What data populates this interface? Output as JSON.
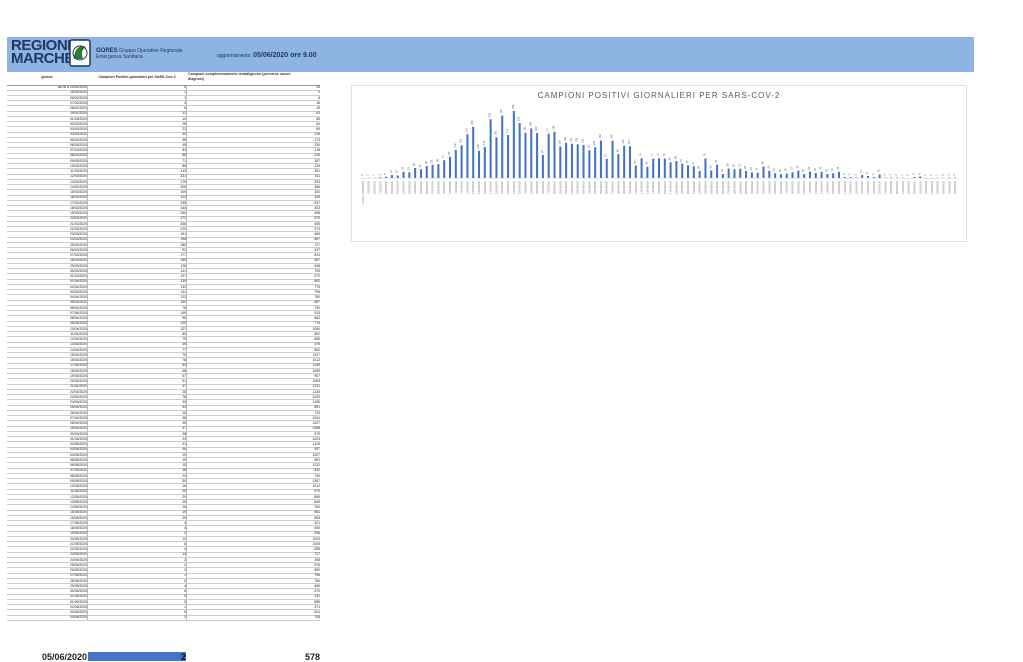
{
  "header": {
    "brand_line1": "REGIONE",
    "brand_line2": "MARCHE",
    "org_name": "GORES",
    "org_desc1": "Gruppo Operativo Regionale",
    "org_desc2": "Emergenza Sanitaria",
    "update_label": "aggiornamento:",
    "update_value": "05/06/2020 ore 9.00"
  },
  "table": {
    "col_day": "giorno",
    "col_positive": "Campioni Positivi giornalieri per SARS-Cov-2",
    "col_tested": "Campioni complessivamente testati/giorno (percorso nuove diagnosi)",
    "rows": [
      {
        "d": "da 06 a 24/02/2020",
        "p": "0",
        "c": "34"
      },
      {
        "d": "25/02/2020",
        "p": "1",
        "c": "3"
      },
      {
        "d": "26/02/2020",
        "p": "1",
        "c": "8"
      },
      {
        "d": "27/02/2020",
        "p": "3",
        "c": "16"
      },
      {
        "d": "28/02/2020",
        "p": "5",
        "c": "19"
      },
      {
        "d": "29/02/2020",
        "p": "12",
        "c": "63"
      },
      {
        "d": "01/03/2020",
        "p": "10",
        "c": "56"
      },
      {
        "d": "02/03/2020",
        "p": "25",
        "c": "64"
      },
      {
        "d": "03/03/2020",
        "p": "23",
        "c": "89"
      },
      {
        "d": "04/03/2020",
        "p": "40",
        "c": "126"
      },
      {
        "d": "05/03/2020",
        "p": "35",
        "c": "173"
      },
      {
        "d": "06/03/2020",
        "p": "48",
        "c": "230"
      },
      {
        "d": "07/03/2020",
        "p": "53",
        "c": "218"
      },
      {
        "d": "08/03/2020",
        "p": "56",
        "c": "216"
      },
      {
        "d": "09/03/2020",
        "p": "71",
        "c": "187"
      },
      {
        "d": "10/03/2020",
        "p": "85",
        "c": "226"
      },
      {
        "d": "11/03/2020",
        "p": "113",
        "c": "351"
      },
      {
        "d": "12/03/2020",
        "p": "131",
        "c": "311"
      },
      {
        "d": "13/03/2020",
        "p": "175",
        "c": "333"
      },
      {
        "d": "14/03/2020",
        "p": "205",
        "c": "386"
      },
      {
        "d": "15/03/2020",
        "p": "109",
        "c": "300"
      },
      {
        "d": "16/03/2020",
        "p": "124",
        "c": "335"
      },
      {
        "d": "17/03/2020",
        "p": "235",
        "c": "537"
      },
      {
        "d": "18/03/2020",
        "p": "163",
        "c": "403"
      },
      {
        "d": "19/03/2020",
        "p": "250",
        "c": "498"
      },
      {
        "d": "20/03/2020",
        "p": "172",
        "c": "570"
      },
      {
        "d": "21/03/2020",
        "p": "268",
        "c": "655"
      },
      {
        "d": "22/03/2020",
        "p": "220",
        "c": "573"
      },
      {
        "d": "23/03/2020",
        "p": "181",
        "c": "465"
      },
      {
        "d": "24/03/2020",
        "p": "198",
        "c": "667"
      },
      {
        "d": "25/03/2020",
        "p": "180",
        "c": "727"
      },
      {
        "d": "26/03/2020",
        "p": "92",
        "c": "437"
      },
      {
        "d": "27/03/2020",
        "p": "177",
        "c": "824"
      },
      {
        "d": "28/03/2020",
        "p": "185",
        "c": "567"
      },
      {
        "d": "29/03/2020",
        "p": "126",
        "c": "548"
      },
      {
        "d": "30/03/2020",
        "p": "141",
        "c": "705"
      },
      {
        "d": "31/03/2020",
        "p": "137",
        "c": "572"
      },
      {
        "d": "01/04/2020",
        "p": "135",
        "c": "662"
      },
      {
        "d": "02/04/2020",
        "p": "132",
        "c": "775"
      },
      {
        "d": "03/04/2020",
        "p": "111",
        "c": "796"
      },
      {
        "d": "04/04/2020",
        "p": "123",
        "c": "780"
      },
      {
        "d": "05/04/2020",
        "p": "150",
        "c": "667"
      },
      {
        "d": "06/04/2020",
        "p": "76",
        "c": "730"
      },
      {
        "d": "07/04/2020",
        "p": "149",
        "c": "913"
      },
      {
        "d": "08/04/2020",
        "p": "96",
        "c": "662"
      },
      {
        "d": "09/04/2020",
        "p": "129",
        "c": "776"
      },
      {
        "d": "10/04/2020",
        "p": "127",
        "c": "1090"
      },
      {
        "d": "11/04/2020",
        "p": "50",
        "c": "892"
      },
      {
        "d": "12/04/2020",
        "p": "79",
        "c": "656"
      },
      {
        "d": "13/04/2020",
        "p": "45",
        "c": "476"
      },
      {
        "d": "14/04/2020",
        "p": "77",
        "c": "862"
      },
      {
        "d": "15/04/2020",
        "p": "79",
        "c": "1107"
      },
      {
        "d": "16/04/2020",
        "p": "78",
        "c": "1012"
      },
      {
        "d": "17/04/2020",
        "p": "63",
        "c": "1265"
      },
      {
        "d": "18/04/2020",
        "p": "68",
        "c": "1099"
      },
      {
        "d": "19/04/2020",
        "p": "57",
        "c": "907"
      },
      {
        "d": "20/04/2020",
        "p": "51",
        "c": "1063"
      },
      {
        "d": "21/04/2020",
        "p": "47",
        "c": "1011"
      },
      {
        "d": "22/04/2020",
        "p": "28",
        "c": "1130"
      },
      {
        "d": "23/04/2020",
        "p": "78",
        "c": "1020"
      },
      {
        "d": "24/04/2020",
        "p": "30",
        "c": "1155"
      },
      {
        "d": "25/04/2020",
        "p": "53",
        "c": "851"
      },
      {
        "d": "26/04/2020",
        "p": "16",
        "c": "733"
      },
      {
        "d": "27/04/2020",
        "p": "38",
        "c": "1004"
      },
      {
        "d": "28/04/2020",
        "p": "35",
        "c": "1227"
      },
      {
        "d": "29/04/2020",
        "p": "37",
        "c": "1268"
      },
      {
        "d": "30/04/2020",
        "p": "28",
        "c": "979"
      },
      {
        "d": "01/05/2020",
        "p": "23",
        "c": "1003"
      },
      {
        "d": "02/05/2020",
        "p": "21",
        "c": "1125"
      },
      {
        "d": "03/05/2020",
        "p": "46",
        "c": "957"
      },
      {
        "d": "04/05/2020",
        "p": "29",
        "c": "1207"
      },
      {
        "d": "05/05/2020",
        "p": "19",
        "c": "981"
      },
      {
        "d": "06/05/2020",
        "p": "15",
        "c": "1232"
      },
      {
        "d": "07/05/2020",
        "p": "18",
        "c": "832"
      },
      {
        "d": "08/05/2020",
        "p": "23",
        "c": "735"
      },
      {
        "d": "09/05/2020",
        "p": "30",
        "c": "1367"
      },
      {
        "d": "10/05/2020",
        "p": "16",
        "c": "1012"
      },
      {
        "d": "11/05/2020",
        "p": "25",
        "c": "970"
      },
      {
        "d": "12/05/2020",
        "p": "20",
        "c": "865"
      },
      {
        "d": "13/05/2020",
        "p": "25",
        "c": "849"
      },
      {
        "d": "14/05/2020",
        "p": "16",
        "c": "760"
      },
      {
        "d": "15/05/2020",
        "p": "19",
        "c": "981"
      },
      {
        "d": "16/05/2020",
        "p": "25",
        "c": "863"
      },
      {
        "d": "17/05/2020",
        "p": "4",
        "c": "321"
      },
      {
        "d": "18/05/2020",
        "p": "4",
        "c": "690"
      },
      {
        "d": "19/05/2020",
        "p": "2",
        "c": "936"
      },
      {
        "d": "20/05/2020",
        "p": "12",
        "c": "1003"
      },
      {
        "d": "21/05/2020",
        "p": "8",
        "c": "1006"
      },
      {
        "d": "22/05/2020",
        "p": "4",
        "c": "558"
      },
      {
        "d": "23/05/2020",
        "p": "14",
        "c": "717"
      },
      {
        "d": "24/05/2020",
        "p": "2",
        "c": "398"
      },
      {
        "d": "25/05/2020",
        "p": "2",
        "c": "576"
      },
      {
        "d": "26/05/2020",
        "p": "2",
        "c": "890"
      },
      {
        "d": "27/05/2020",
        "p": "1",
        "c": "796"
      },
      {
        "d": "28/05/2020",
        "p": "0",
        "c": "750"
      },
      {
        "d": "29/05/2020",
        "p": "4",
        "c": "586"
      },
      {
        "d": "30/05/2020",
        "p": "6",
        "c": "670"
      },
      {
        "d": "31/05/2020",
        "p": "0",
        "c": "231"
      },
      {
        "d": "01/06/2020",
        "p": "0",
        "c": "589"
      },
      {
        "d": "02/06/2020",
        "p": "1",
        "c": "371"
      },
      {
        "d": "03/06/2020",
        "p": "0",
        "c": "624"
      },
      {
        "d": "04/06/2020",
        "p": "2",
        "c": "708"
      }
    ],
    "footer_date": "05/06/2020",
    "footer_positive": "2",
    "footer_tested": "578"
  },
  "colors": {
    "header_bg": "#8db4e2",
    "bar": "#4472c4",
    "brand": "#1f3864"
  },
  "chart_data": {
    "type": "bar",
    "title": "CAMPIONI POSITIVI GIORNALIERI PER SARS-COV-2",
    "xlabel": "",
    "ylabel": "",
    "grid": false,
    "categories": [
      "da 06 a 24/02/2020",
      "25/02/2020",
      "26/02/2020",
      "27/02/2020",
      "28/02/2020",
      "29/02/2020",
      "01/03/2020",
      "02/03/2020",
      "03/03/2020",
      "04/03/2020",
      "05/03/2020",
      "06/03/2020",
      "07/03/2020",
      "08/03/2020",
      "09/03/2020",
      "10/03/2020",
      "11/03/2020",
      "12/03/2020",
      "13/03/2020",
      "14/03/2020",
      "15/03/2020",
      "16/03/2020",
      "17/03/2020",
      "18/03/2020",
      "19/03/2020",
      "20/03/2020",
      "21/03/2020",
      "22/03/2020",
      "23/03/2020",
      "24/03/2020",
      "25/03/2020",
      "26/03/2020",
      "27/03/2020",
      "28/03/2020",
      "29/03/2020",
      "30/03/2020",
      "31/03/2020",
      "01/04/2020",
      "02/04/2020",
      "03/04/2020",
      "04/04/2020",
      "05/04/2020",
      "06/04/2020",
      "07/04/2020",
      "08/04/2020",
      "09/04/2020",
      "10/04/2020",
      "11/04/2020",
      "12/04/2020",
      "13/04/2020",
      "14/04/2020",
      "15/04/2020",
      "16/04/2020",
      "17/04/2020",
      "18/04/2020",
      "19/04/2020",
      "20/04/2020",
      "21/04/2020",
      "22/04/2020",
      "23/04/2020",
      "24/04/2020",
      "25/04/2020",
      "26/04/2020",
      "27/04/2020",
      "28/04/2020",
      "29/04/2020",
      "30/04/2020",
      "01/05/2020",
      "02/05/2020",
      "03/05/2020",
      "04/05/2020",
      "05/05/2020",
      "06/05/2020",
      "07/05/2020",
      "08/05/2020",
      "09/05/2020",
      "10/05/2020",
      "11/05/2020",
      "12/05/2020",
      "13/05/2020",
      "14/05/2020",
      "15/05/2020",
      "16/05/2020",
      "17/05/2020",
      "18/05/2020",
      "19/05/2020",
      "20/05/2020",
      "21/05/2020",
      "22/05/2020",
      "23/05/2020",
      "24/05/2020",
      "25/05/2020",
      "26/05/2020",
      "27/05/2020",
      "28/05/2020",
      "29/05/2020",
      "30/05/2020",
      "31/05/2020",
      "01/06/2020",
      "02/06/2020",
      "03/06/2020",
      "04/06/2020",
      "05/06/2020"
    ],
    "values": [
      0,
      1,
      1,
      3,
      5,
      12,
      10,
      25,
      23,
      40,
      35,
      48,
      53,
      56,
      71,
      85,
      113,
      131,
      175,
      205,
      109,
      124,
      235,
      163,
      250,
      172,
      268,
      220,
      181,
      198,
      180,
      92,
      177,
      185,
      126,
      141,
      137,
      135,
      132,
      111,
      123,
      150,
      76,
      149,
      96,
      129,
      127,
      50,
      79,
      45,
      77,
      79,
      78,
      63,
      68,
      57,
      51,
      47,
      28,
      78,
      30,
      53,
      16,
      38,
      35,
      37,
      28,
      23,
      21,
      46,
      29,
      19,
      15,
      18,
      23,
      30,
      16,
      25,
      20,
      25,
      16,
      19,
      25,
      4,
      4,
      2,
      12,
      8,
      4,
      14,
      2,
      2,
      2,
      1,
      0,
      4,
      6,
      0,
      0,
      1,
      0,
      2,
      2
    ],
    "ylim": [
      0,
      280
    ]
  }
}
